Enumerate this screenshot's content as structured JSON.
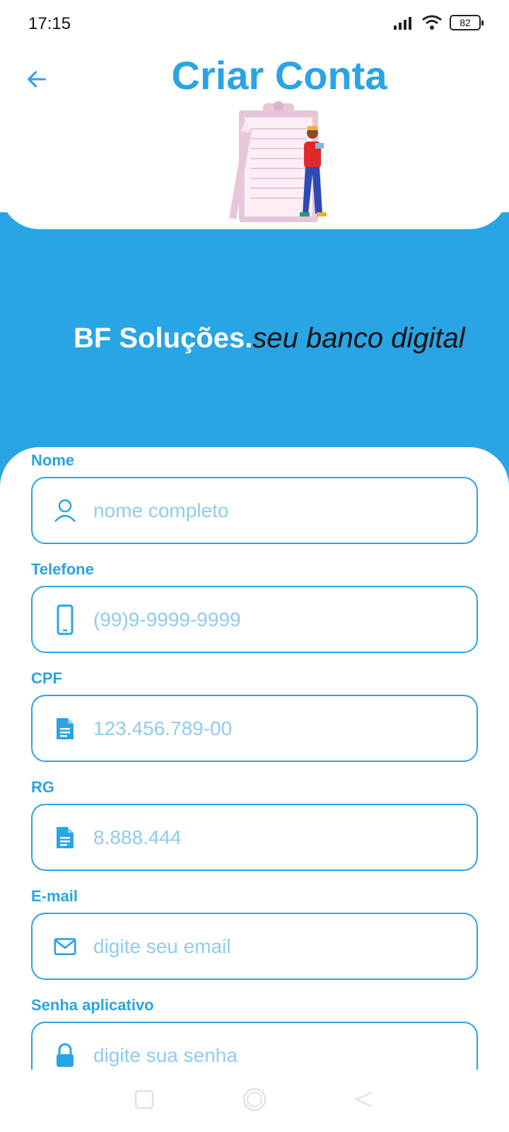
{
  "status_bar": {
    "time": "17:15",
    "battery": "82"
  },
  "header": {
    "title": "Criar Conta"
  },
  "brand": {
    "name": "BF Soluções.",
    "tagline": "seu banco digital"
  },
  "form": {
    "fields": [
      {
        "label": "Nome",
        "placeholder": "nome completo",
        "icon": "person-icon"
      },
      {
        "label": "Telefone",
        "placeholder": "(99)9-9999-9999",
        "icon": "phone-icon"
      },
      {
        "label": "CPF",
        "placeholder": "123.456.789-00",
        "icon": "document-icon"
      },
      {
        "label": "RG",
        "placeholder": "8.888.444",
        "icon": "document-icon"
      },
      {
        "label": "E-mail",
        "placeholder": "digite seu email",
        "icon": "mail-icon"
      },
      {
        "label": "Senha aplicativo",
        "placeholder": "digite sua senha",
        "icon": "lock-icon"
      }
    ]
  },
  "colors": {
    "accent": "#29A4E4",
    "placeholder": "#8FCBEE"
  }
}
